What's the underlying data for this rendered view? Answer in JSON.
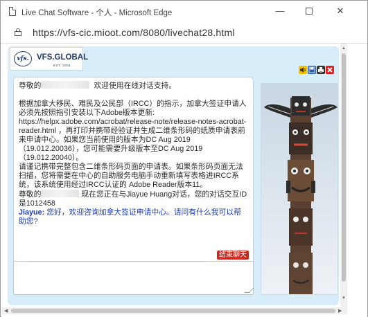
{
  "window": {
    "title": "Live Chat Software - 个人 - Microsoft Edge",
    "minimize_glyph": "—",
    "close_glyph": "✕"
  },
  "address": {
    "url": "https://vfs-cic.mioot.com/8080/livechat28.html"
  },
  "logo": {
    "mark": "vfs.",
    "name": "VFS.GLOBAL",
    "sub": "EST. 2001"
  },
  "toolbar": {
    "icons": [
      "sound-icon",
      "save-icon",
      "print-icon",
      "close-icon"
    ],
    "colors": {
      "sound": "#f2c200",
      "save": "#2a5fb0",
      "print": "#333333",
      "close": "#e21c1c"
    }
  },
  "transcript": {
    "greeting_prefix": "尊敬的",
    "greeting_suffix": "欢迎使用在线对话支持。",
    "notice": "根据加拿大移民、难民及公民部（IRCC）的指示，加拿大签证申请人必须先按照指引安装以下Adobe版本更新: https://helpx.adobe.com/acrobat/release-note/release-notes-acrobat-reader.html ，再打印并携带经验证并生成二维条形码的纸质申请表前来申请中心。如果您当前使用的版本为DC Aug 2019（19.012.20036），您可能需要升级版本至DC Aug 2019（19.012.20040）。",
    "notice2": "请谨记携带完整包含二维条形码页面的申请表。如果条形码页面无法扫描，您将需要在中心的自助服务电脑手动重新填写表格进IRCC系统，该系统使用经过IRCC认证的 Adobe Reader版本11。",
    "session_prefix": "尊敬的",
    "session_suffix": "现在您正在与Jiayue Huang对话，您的对话交互ID是1012458",
    "agent_name": "Jiayue:",
    "agent_message": "您好，欢迎咨询加拿大签证申请中心。请问有什么我可以帮助您?"
  },
  "end_chat_label": "结束聊天",
  "input": {
    "value": "",
    "placeholder": ""
  },
  "colors": {
    "panel_bg": "#d7eefa",
    "agent_text": "#1a39b8",
    "end_chat_bg": "#c8281e"
  }
}
